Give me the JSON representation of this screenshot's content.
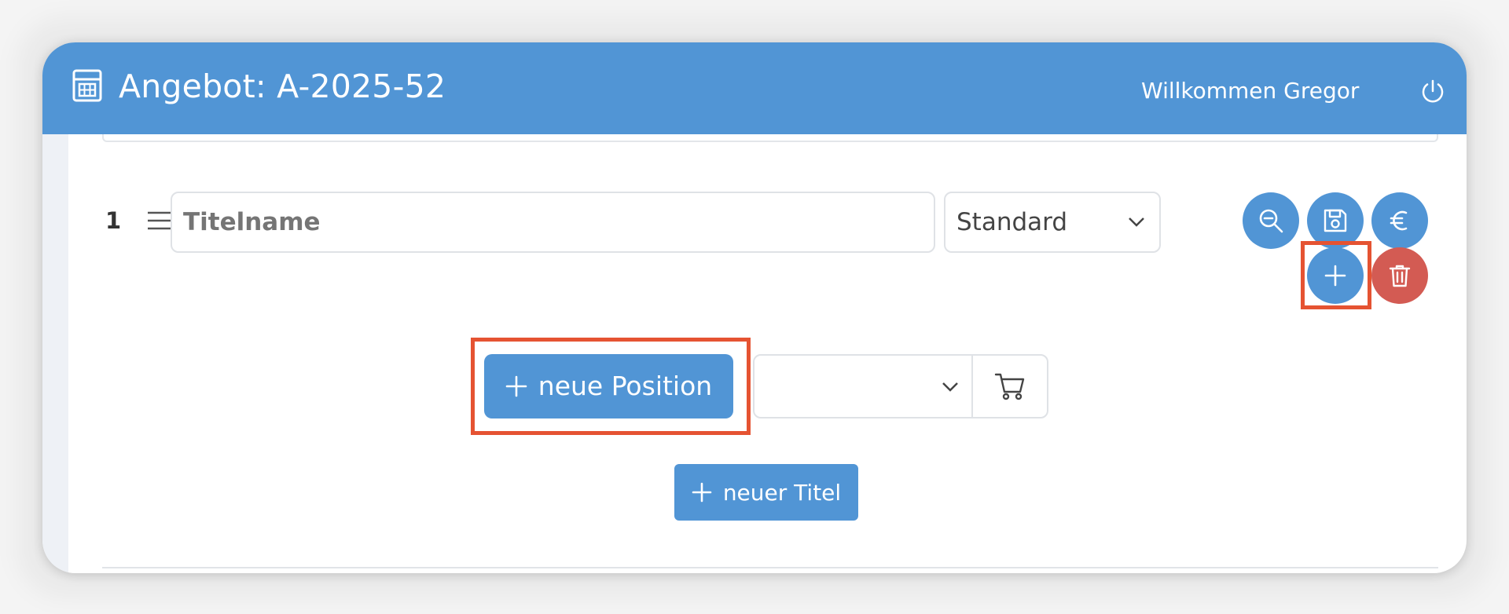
{
  "header": {
    "title": "Angebot: A-2025-52",
    "app_icon": "calculator-icon",
    "welcome": "Willkommen Gregor",
    "power_icon": "power-icon",
    "background": "#5195d5"
  },
  "title_row": {
    "number": "1",
    "drag_icon": "drag-handle-icon",
    "title_input": {
      "value": "",
      "placeholder": "Titelname"
    },
    "type_select": {
      "selected": "Standard"
    },
    "actions": [
      {
        "icon": "zoom-out-icon"
      },
      {
        "icon": "save-icon"
      },
      {
        "icon": "euro-icon"
      },
      {
        "icon": "plus-icon"
      },
      {
        "icon": "trash-icon",
        "color": "#d35b53"
      }
    ]
  },
  "position_bar": {
    "new_position_label": "neue Position",
    "article_select": {
      "selected": ""
    },
    "cart_icon": "cart-icon"
  },
  "new_title_label": "neuer Titel",
  "highlight_color": "#e55332"
}
